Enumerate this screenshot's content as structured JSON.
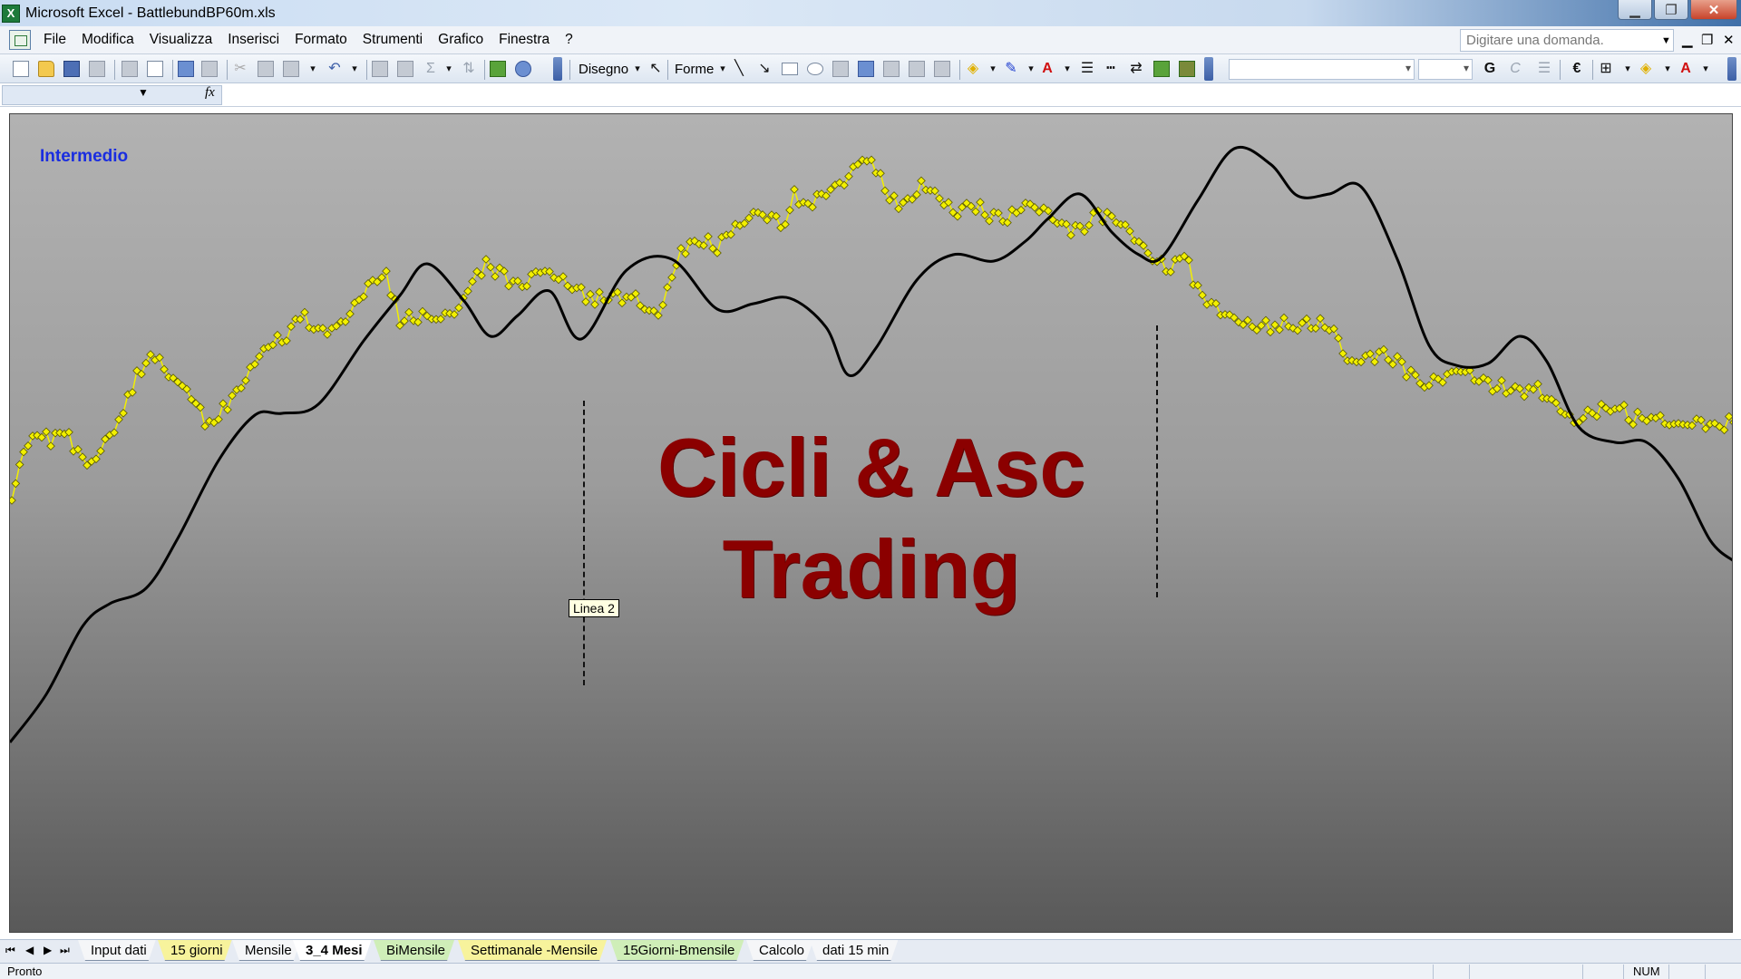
{
  "window": {
    "title": "Microsoft Excel - BattlebundBP60m.xls",
    "app_icon_letter": "X"
  },
  "menu": {
    "items": [
      "File",
      "Modifica",
      "Visualizza",
      "Inserisci",
      "Formato",
      "Strumenti",
      "Grafico",
      "Finestra",
      "?"
    ],
    "help_placeholder": "Digitare una domanda."
  },
  "toolbar": {
    "draw_label": "Disegno",
    "shapes_label": "Forme",
    "bold_label": "G",
    "italic_label": "C",
    "currency_label": "€",
    "sigma_label": "Σ",
    "font_color_label": "A"
  },
  "formula_bar": {
    "fx_label": "fx"
  },
  "chart": {
    "label": "Intermedio",
    "watermark_line1": "Cicli & Asc",
    "watermark_line2": "Trading",
    "tooltip": "Linea 2",
    "colors": {
      "price_line": "#f2ef00",
      "price_marker_border": "#5a5a00",
      "cycle_line": "#000000",
      "watermark": "#8b0000",
      "label": "#1a2de0"
    }
  },
  "sheets": {
    "tabs": [
      {
        "label": "Input dati",
        "style": "white"
      },
      {
        "label": "15 giorni",
        "style": "yellow"
      },
      {
        "label": "Mensile",
        "style": "white"
      },
      {
        "label": "3_4 Mesi",
        "style": "active"
      },
      {
        "label": "BiMensile",
        "style": "green"
      },
      {
        "label": "Settimanale -Mensile",
        "style": "yellow"
      },
      {
        "label": "15Giorni-Bmensile",
        "style": "green"
      },
      {
        "label": "Calcolo",
        "style": "white"
      },
      {
        "label": "dati 15 min",
        "style": "white"
      }
    ]
  },
  "status": {
    "left": "Pronto",
    "num": "NUM"
  }
}
